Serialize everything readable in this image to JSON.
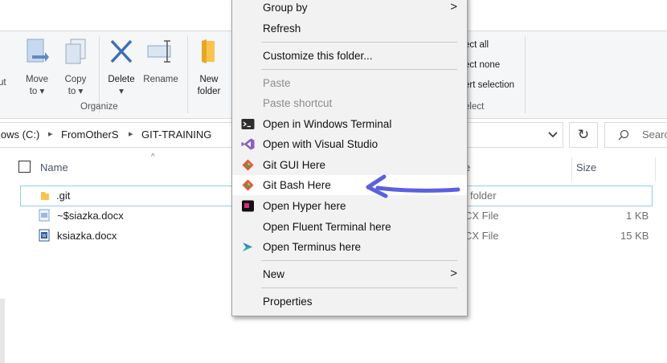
{
  "ribbon": {
    "cut_partial": "ut",
    "move_to": [
      "Move",
      "to ▾"
    ],
    "copy_to": [
      "Copy",
      "to ▾"
    ],
    "delete": [
      "Delete",
      "▾"
    ],
    "rename": "Rename",
    "new_folder": [
      "New",
      "folder"
    ],
    "organize_label": "Organize",
    "select_all": "ect all",
    "select_none": "ect none",
    "invert_selection": "ert selection",
    "select_label": "elect"
  },
  "address": {
    "drive": "lows (C:)",
    "folder1": "FromOtherS",
    "folder2": "GIT-TRAINING"
  },
  "search": {
    "placeholder": "Search"
  },
  "columns": {
    "name": "Name",
    "type": "e",
    "size": "Size"
  },
  "files": [
    {
      "name": ".git",
      "type": "folder",
      "size": ""
    },
    {
      "name": "~$siazka.docx",
      "type": "CX File",
      "size": "1 KB"
    },
    {
      "name": "ksiazka.docx",
      "type": "CX File",
      "size": "15 KB"
    }
  ],
  "context_menu": {
    "items": [
      {
        "label": "Group by",
        "submenu": true
      },
      {
        "label": "Refresh"
      },
      {
        "label": "Customize this folder..."
      },
      {
        "label": "Paste",
        "disabled": true
      },
      {
        "label": "Paste shortcut",
        "disabled": true
      },
      {
        "label": "Open in Windows Terminal",
        "icon": "windows-terminal-icon"
      },
      {
        "label": "Open with Visual Studio",
        "icon": "visual-studio-icon"
      },
      {
        "label": "Git GUI Here",
        "icon": "git-icon"
      },
      {
        "label": "Git Bash Here",
        "icon": "git-icon"
      },
      {
        "label": "Open Hyper here",
        "icon": "hyper-icon"
      },
      {
        "label": "Open Fluent Terminal here"
      },
      {
        "label": "Open Terminus here",
        "icon": "terminus-icon"
      },
      {
        "label": "New",
        "submenu": true
      },
      {
        "label": "Properties"
      }
    ],
    "submenu_arrow": ">"
  },
  "colors": {
    "annotation_arrow": "#5b5fe0",
    "git": "#f05033",
    "vs": "#8661c5"
  }
}
